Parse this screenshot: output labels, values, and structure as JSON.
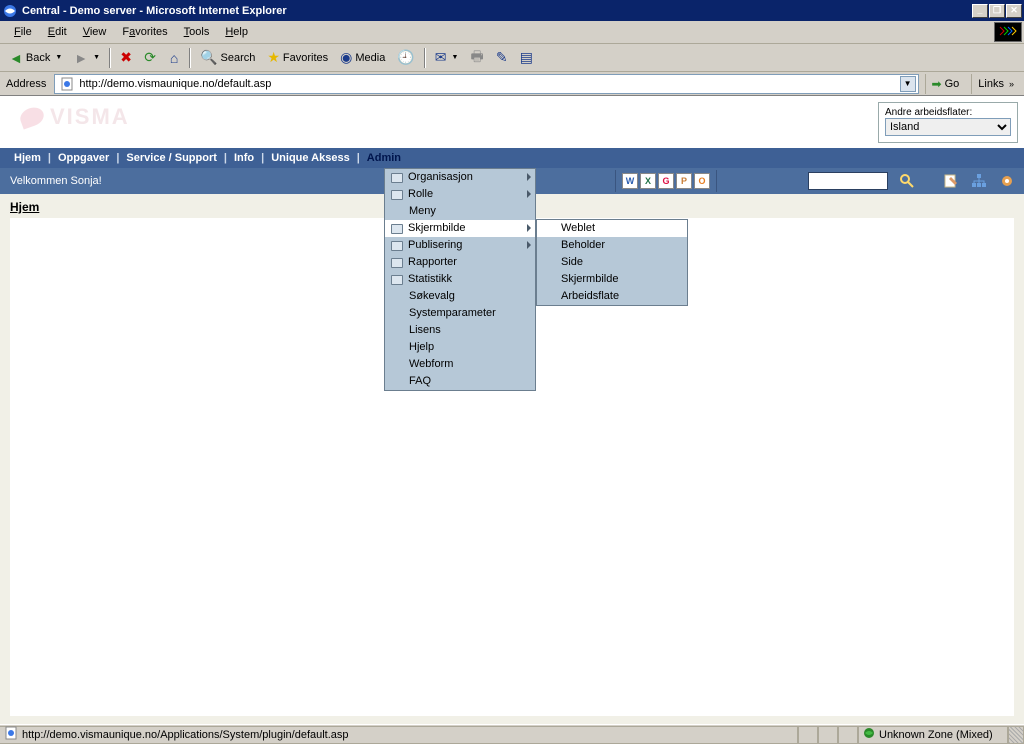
{
  "window": {
    "title": "Central - Demo server - Microsoft Internet Explorer"
  },
  "ie_menu": [
    "File",
    "Edit",
    "View",
    "Favorites",
    "Tools",
    "Help"
  ],
  "ie_toolbar": {
    "back": "Back",
    "search": "Search",
    "favorites": "Favorites",
    "media": "Media"
  },
  "address": {
    "label": "Address",
    "url": "http://demo.vismaunique.no/default.asp",
    "go": "Go",
    "links": "Links"
  },
  "brand": "VISMA",
  "workspace_box": {
    "label": "Andre arbeidsflater:",
    "selected": "Island"
  },
  "nav": {
    "items": [
      "Hjem",
      "Oppgaver",
      "Service / Support",
      "Info",
      "Unique Aksess",
      "Admin"
    ],
    "active_index": 5
  },
  "subbar": {
    "welcome": "Velkommen Sonja!"
  },
  "page_heading": "Hjem",
  "admin_menu": [
    {
      "label": "Organisasjon",
      "folder": true,
      "arrow": true
    },
    {
      "label": "Rolle",
      "folder": true,
      "arrow": true
    },
    {
      "label": "Meny",
      "folder": false,
      "arrow": false,
      "indent": true
    },
    {
      "label": "Skjermbilde",
      "folder": true,
      "arrow": true,
      "hover": true
    },
    {
      "label": "Publisering",
      "folder": true,
      "arrow": true
    },
    {
      "label": "Rapporter",
      "folder": true,
      "arrow": false
    },
    {
      "label": "Statistikk",
      "folder": true,
      "arrow": false
    },
    {
      "label": "Søkevalg",
      "folder": false,
      "arrow": false,
      "indent": true
    },
    {
      "label": "Systemparameter",
      "folder": false,
      "arrow": false,
      "indent": true
    },
    {
      "label": "Lisens",
      "folder": false,
      "arrow": false,
      "indent": true
    },
    {
      "label": "Hjelp",
      "folder": false,
      "arrow": false,
      "indent": true
    },
    {
      "label": "Webform",
      "folder": false,
      "arrow": false,
      "indent": true
    },
    {
      "label": "FAQ",
      "folder": false,
      "arrow": false,
      "indent": true
    }
  ],
  "submenu": [
    {
      "label": "Weblet",
      "hover": true
    },
    {
      "label": "Beholder"
    },
    {
      "label": "Side"
    },
    {
      "label": "Skjermbilde"
    },
    {
      "label": "Arbeidsflate"
    }
  ],
  "doc_icons": [
    "W",
    "X",
    "G",
    "P",
    "O"
  ],
  "doc_icon_colors": [
    "#2a5db0",
    "#217346",
    "#d14",
    "#c77c36",
    "#e67e22"
  ],
  "statusbar": {
    "text": "http://demo.vismaunique.no/Applications/System/plugin/default.asp",
    "zone": "Unknown Zone (Mixed)"
  }
}
